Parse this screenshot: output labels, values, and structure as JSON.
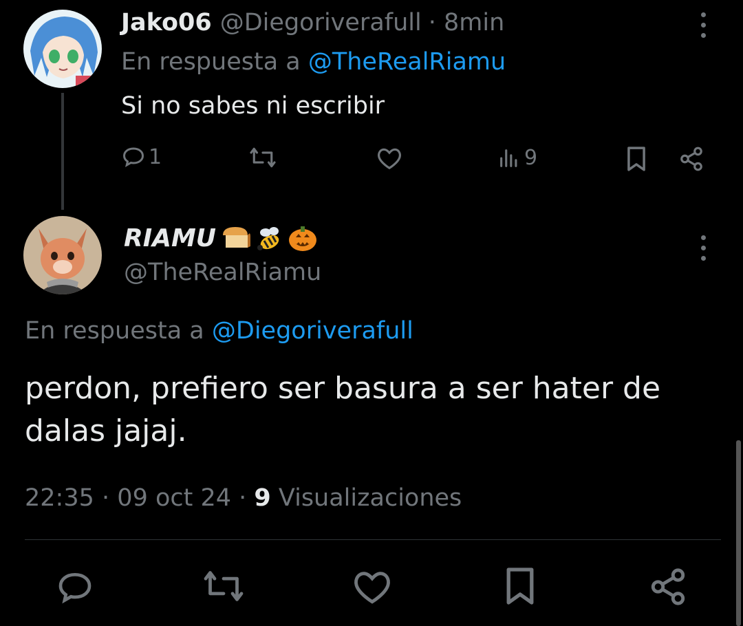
{
  "reply_tweet": {
    "display_name": "Jako06",
    "handle": "@Diegoriverafull",
    "time": "· 8min",
    "reply_prefix": "En respuesta a",
    "reply_to": "@TheRealRiamu",
    "text": "Si no sabes ni escribir",
    "reply_count": "1",
    "view_count": "9"
  },
  "main_tweet": {
    "display_name": "RIAMU",
    "emojis": [
      "bread-emoji",
      "bee-emoji",
      "pumpkin-emoji"
    ],
    "handle": "@TheRealRiamu",
    "reply_prefix": "En respuesta a",
    "reply_to": "@Diegoriverafull",
    "text_line1": "perdon, prefiero ser basura a ser hater de",
    "text_line2": "dalas jajaj.",
    "time": "22:35",
    "date": "09 oct 24",
    "separator": "·",
    "views_count": "9",
    "views_label": "Visualizaciones"
  },
  "colors": {
    "background": "#000000",
    "text": "#e7e9ea",
    "muted": "#71767b",
    "link": "#1d9bf0"
  }
}
